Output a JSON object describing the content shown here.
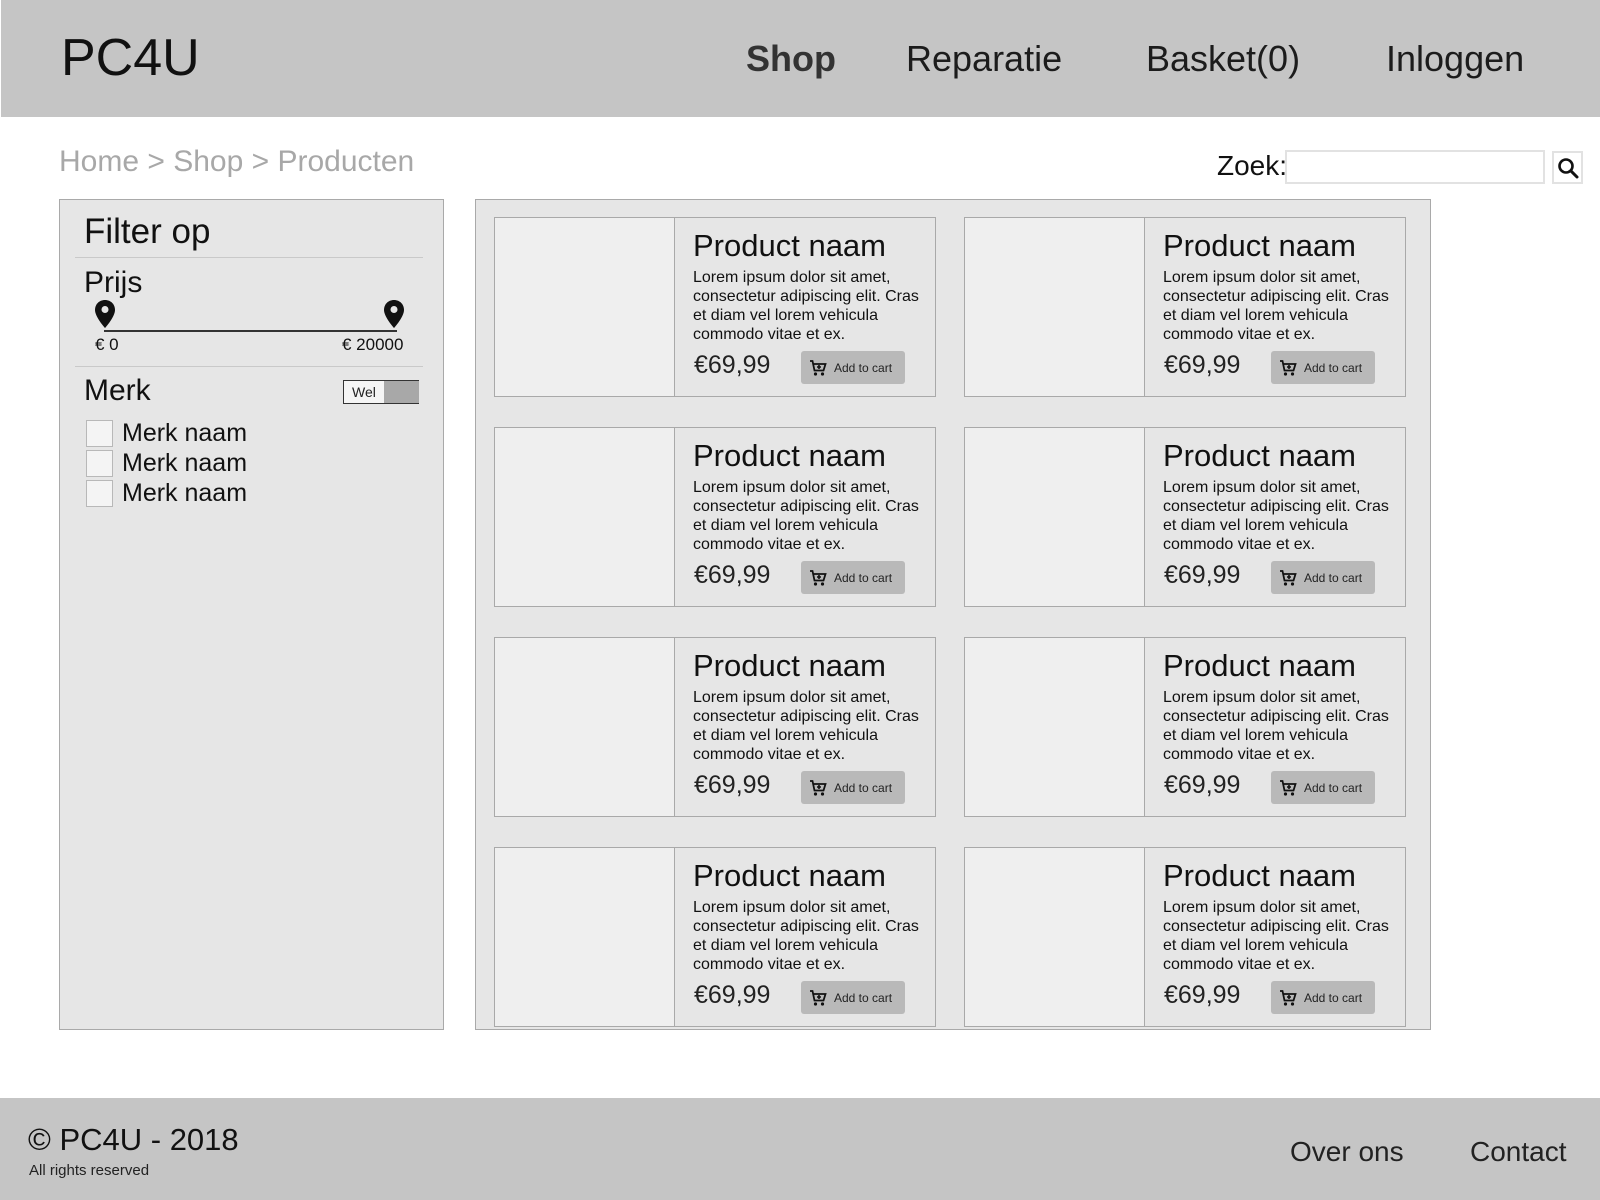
{
  "header": {
    "logo": "PC4U",
    "nav": [
      {
        "label": "Shop",
        "active": true
      },
      {
        "label": "Reparatie",
        "active": false
      },
      {
        "label": "Basket(0)",
        "active": false
      },
      {
        "label": "Inloggen",
        "active": false
      }
    ]
  },
  "breadcrumb": "Home > Shop > Producten",
  "search": {
    "label": "Zoek:",
    "value": "",
    "button_icon": "search-icon"
  },
  "filter": {
    "title": "Filter op",
    "price": {
      "title": "Prijs",
      "min_label": "€ 0",
      "max_label": "€ 20000",
      "handle_icon": "map-pin-icon"
    },
    "brand": {
      "title": "Merk",
      "toggle_label": "Wel",
      "items": [
        {
          "label": "Merk naam",
          "checked": false
        },
        {
          "label": "Merk naam",
          "checked": false
        },
        {
          "label": "Merk naam",
          "checked": false
        }
      ]
    }
  },
  "products": [
    {
      "name": "Product naam",
      "description": "Lorem ipsum dolor sit amet, consectetur adipiscing elit. Cras et diam vel lorem vehicula commodo vitae et ex.",
      "price": "€69,99",
      "cart_label": "Add to cart"
    },
    {
      "name": "Product naam",
      "description": "Lorem ipsum dolor sit amet, consectetur adipiscing elit. Cras et diam vel lorem vehicula commodo vitae et ex.",
      "price": "€69,99",
      "cart_label": "Add to cart"
    },
    {
      "name": "Product naam",
      "description": "Lorem ipsum dolor sit amet, consectetur adipiscing elit. Cras et diam vel lorem vehicula commodo vitae et ex.",
      "price": "€69,99",
      "cart_label": "Add to cart"
    },
    {
      "name": "Product naam",
      "description": "Lorem ipsum dolor sit amet, consectetur adipiscing elit. Cras et diam vel lorem vehicula commodo vitae et ex.",
      "price": "€69,99",
      "cart_label": "Add to cart"
    },
    {
      "name": "Product naam",
      "description": "Lorem ipsum dolor sit amet, consectetur adipiscing elit. Cras et diam vel lorem vehicula commodo vitae et ex.",
      "price": "€69,99",
      "cart_label": "Add to cart"
    },
    {
      "name": "Product naam",
      "description": "Lorem ipsum dolor sit amet, consectetur adipiscing elit. Cras et diam vel lorem vehicula commodo vitae et ex.",
      "price": "€69,99",
      "cart_label": "Add to cart"
    },
    {
      "name": "Product naam",
      "description": "Lorem ipsum dolor sit amet, consectetur adipiscing elit. Cras et diam vel lorem vehicula commodo vitae et ex.",
      "price": "€69,99",
      "cart_label": "Add to cart"
    },
    {
      "name": "Product naam",
      "description": "Lorem ipsum dolor sit amet, consectetur adipiscing elit. Cras et diam vel lorem vehicula commodo vitae et ex.",
      "price": "€69,99",
      "cart_label": "Add to cart"
    }
  ],
  "footer": {
    "copyright": "© PC4U - 2018",
    "rights": "All rights reserved",
    "links": [
      "Over ons",
      "Contact"
    ]
  },
  "colors": {
    "header_bg": "#c5c5c5",
    "panel_bg": "#e6e6e6",
    "button_bg": "#b9b9b9"
  }
}
